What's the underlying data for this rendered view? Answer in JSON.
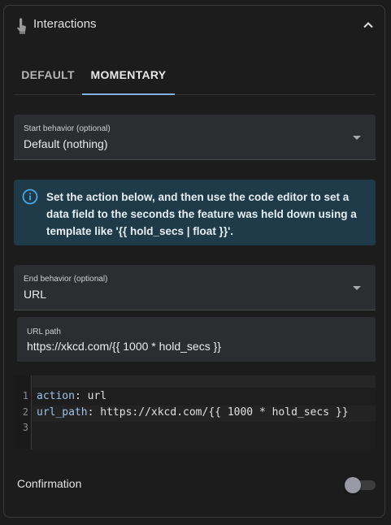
{
  "header": {
    "title": "Interactions",
    "icon": "touch-icon",
    "collapse_icon": "chevron-up-icon"
  },
  "tabs": [
    {
      "label": "DEFAULT",
      "selected": false
    },
    {
      "label": "MOMENTARY",
      "selected": true
    }
  ],
  "start_behavior": {
    "label": "Start behavior (optional)",
    "value": "Default (nothing)"
  },
  "info": {
    "icon": "info-icon",
    "text": "Set the action below, and then use the code editor to set a data field to the seconds the feature was held down using a template like '{{ hold_secs | float }}'."
  },
  "end_behavior": {
    "label": "End behavior (optional)",
    "value": "URL"
  },
  "url_path": {
    "label": "URL path",
    "value": "https://xkcd.com/{{ 1000 * hold_secs }}"
  },
  "code_editor": {
    "line_numbers": [
      "1",
      "2",
      "3"
    ],
    "lines": [
      {
        "key": "action",
        "sep": ": ",
        "value": "url"
      },
      {
        "key": "url_path",
        "sep": ": ",
        "value": "https://xkcd.com/{{ 1000 * hold_secs }}"
      },
      {
        "key": "",
        "sep": "",
        "value": ""
      }
    ]
  },
  "confirmation": {
    "label": "Confirmation",
    "enabled": false
  },
  "colors": {
    "accent": "#7fb0e0",
    "info_bg": "#1f3a49",
    "info_icon": "#4aa8e8"
  }
}
